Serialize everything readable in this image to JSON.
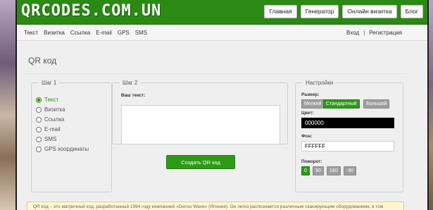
{
  "site": {
    "logo": "QRCODES.COM.UN"
  },
  "topnav": {
    "items": [
      "Главная",
      "Генератор",
      "Онлайн визитка",
      "Блог"
    ]
  },
  "subnav": {
    "left": [
      "Текст",
      "Визитка",
      "Ссылка",
      "E-mail",
      "GPS",
      "SMS"
    ],
    "login": "Вход",
    "separator": "|",
    "register": "Регистрация"
  },
  "page": {
    "title": "QR код"
  },
  "step1": {
    "legend": "Шаг 1",
    "options": [
      "Текст",
      "Визитка",
      "Ссылка",
      "E-mail",
      "SMS",
      "GPS координаты"
    ],
    "selected_index": 0
  },
  "step2": {
    "legend": "Шаг 2",
    "text_label": "Ваш текст:",
    "text_value": ""
  },
  "generate": {
    "label": "Создать QR код"
  },
  "settings": {
    "legend": "Настройки",
    "size_label": "Размер:",
    "sizes": [
      "Мелкий",
      "Стандартный",
      "Большой"
    ],
    "size_selected": "Стандартный",
    "color_label": "Цвет:",
    "color_value": "000000",
    "bg_label": "Фон:",
    "bg_value": "FFFFFF",
    "rotation_label": "Поворот:",
    "rotations": [
      "0",
      "90",
      "180",
      "-90"
    ],
    "rotation_selected": "0"
  },
  "notice": {
    "text": "QR код – это матричный код, разработанный 1994 году компанией «Denso Wave» (Япония). Он легко распознается различным сканирующим оборудованием, в том"
  },
  "colors": {
    "header_green": "#2b8a14",
    "accent_green": "#2e9a18",
    "page_bg": "#efefef"
  }
}
